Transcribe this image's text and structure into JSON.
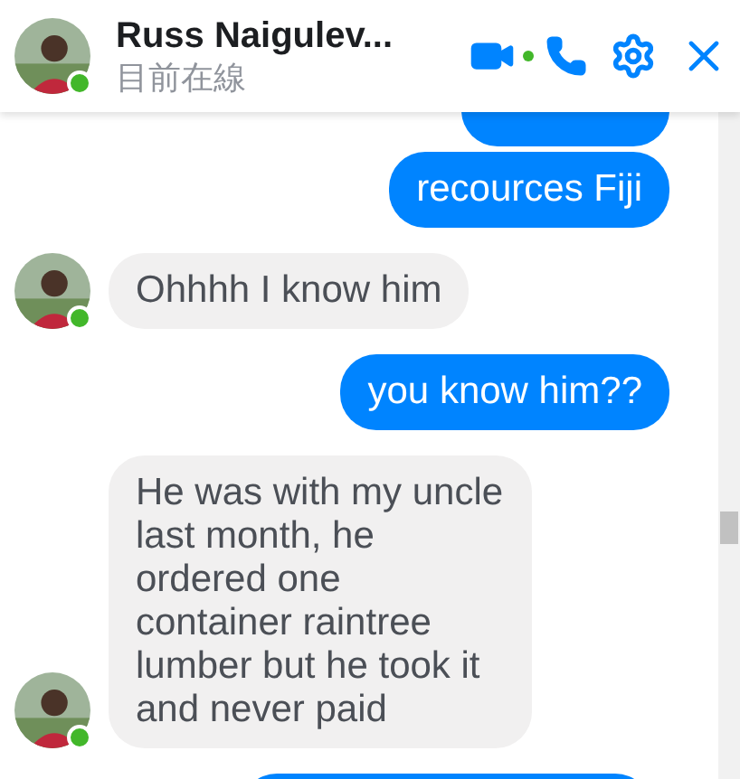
{
  "header": {
    "name": "Russ Naigulev...",
    "status": "目前在線",
    "online": true,
    "video_call_active": true
  },
  "messages": [
    {
      "kind": "sent"
    },
    {
      "kind": "sent",
      "text": "recources Fiji"
    },
    {
      "kind": "received",
      "text": "Ohhhh I know him",
      "avatar": true,
      "online": true
    },
    {
      "kind": "sent",
      "text": "you know him??"
    },
    {
      "kind": "received",
      "text": "He was with my uncle last month, he ordered one container raintree lumber but he took it and never paid",
      "avatar": true,
      "online": true
    },
    {
      "kind": "sent"
    }
  ]
}
